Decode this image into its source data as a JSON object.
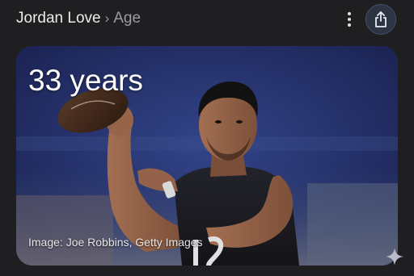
{
  "header": {
    "entity": "Jordan Love",
    "separator": "›",
    "attribute": "Age",
    "more_icon": "more-vertical-icon",
    "share_icon": "share-icon"
  },
  "card": {
    "age_value": "33 years",
    "image_credit": "Image: Joe Robbins, Getty Images",
    "image_subject": "quarterback-throwing-photo"
  },
  "footer": {
    "sparkle_icon": "ai-sparkle-icon"
  },
  "colors": {
    "background": "#1f1f21",
    "share_button_bg": "#2d3444",
    "share_button_border": "#45506a",
    "text_primary": "#ececec",
    "text_secondary": "#9b9ba0"
  }
}
